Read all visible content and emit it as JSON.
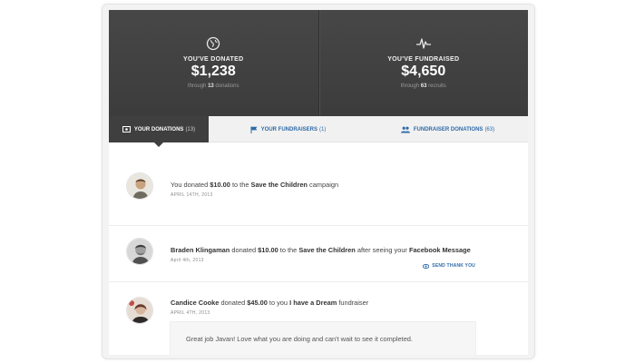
{
  "stats": [
    {
      "icon": "globe-icon",
      "label": "YOU'VE DONATED",
      "value": "$1,238",
      "sub_prefix": "through",
      "sub_count": "13",
      "sub_suffix": "donations"
    },
    {
      "icon": "pulse-icon",
      "label": "YOU'VE FUNDRAISED",
      "value": "$4,650",
      "sub_prefix": "through",
      "sub_count": "63",
      "sub_suffix": "recruits"
    }
  ],
  "tabs": [
    {
      "icon": "money-icon",
      "label": "YOUR DONATIONS",
      "count": "(13)",
      "active": true
    },
    {
      "icon": "flag-icon",
      "label": "YOUR FUNDRAISERS",
      "count": "(1)",
      "active": false
    },
    {
      "icon": "users-icon",
      "label": "FUNDRAISER DONATIONS",
      "count": "(63)",
      "active": false
    }
  ],
  "feed": [
    {
      "parts": [
        "You donated ",
        "$10.00",
        " to the ",
        "Save the Children",
        " campaign"
      ],
      "date": "APRIL 14TH, 2013"
    },
    {
      "parts": [
        "Braden Klingaman",
        " donated ",
        "$10.00",
        " to the ",
        "Save the Children",
        " after seeing your ",
        "Facebook Message"
      ],
      "date": "April 4th, 2013",
      "action": "SEND THANK YOU"
    },
    {
      "parts": [
        "Candice Cooke",
        " donated ",
        "$45.00",
        " to you ",
        "I have a Dream",
        " fundraiser"
      ],
      "date": "APRIL 4TH, 2013",
      "message": "Great job Javan! Love what you are doing and can't wait to see it completed."
    }
  ],
  "colors": {
    "header_bg": "#424242",
    "accent": "#2d6aa8",
    "active_tab": "#3f3f3f"
  }
}
